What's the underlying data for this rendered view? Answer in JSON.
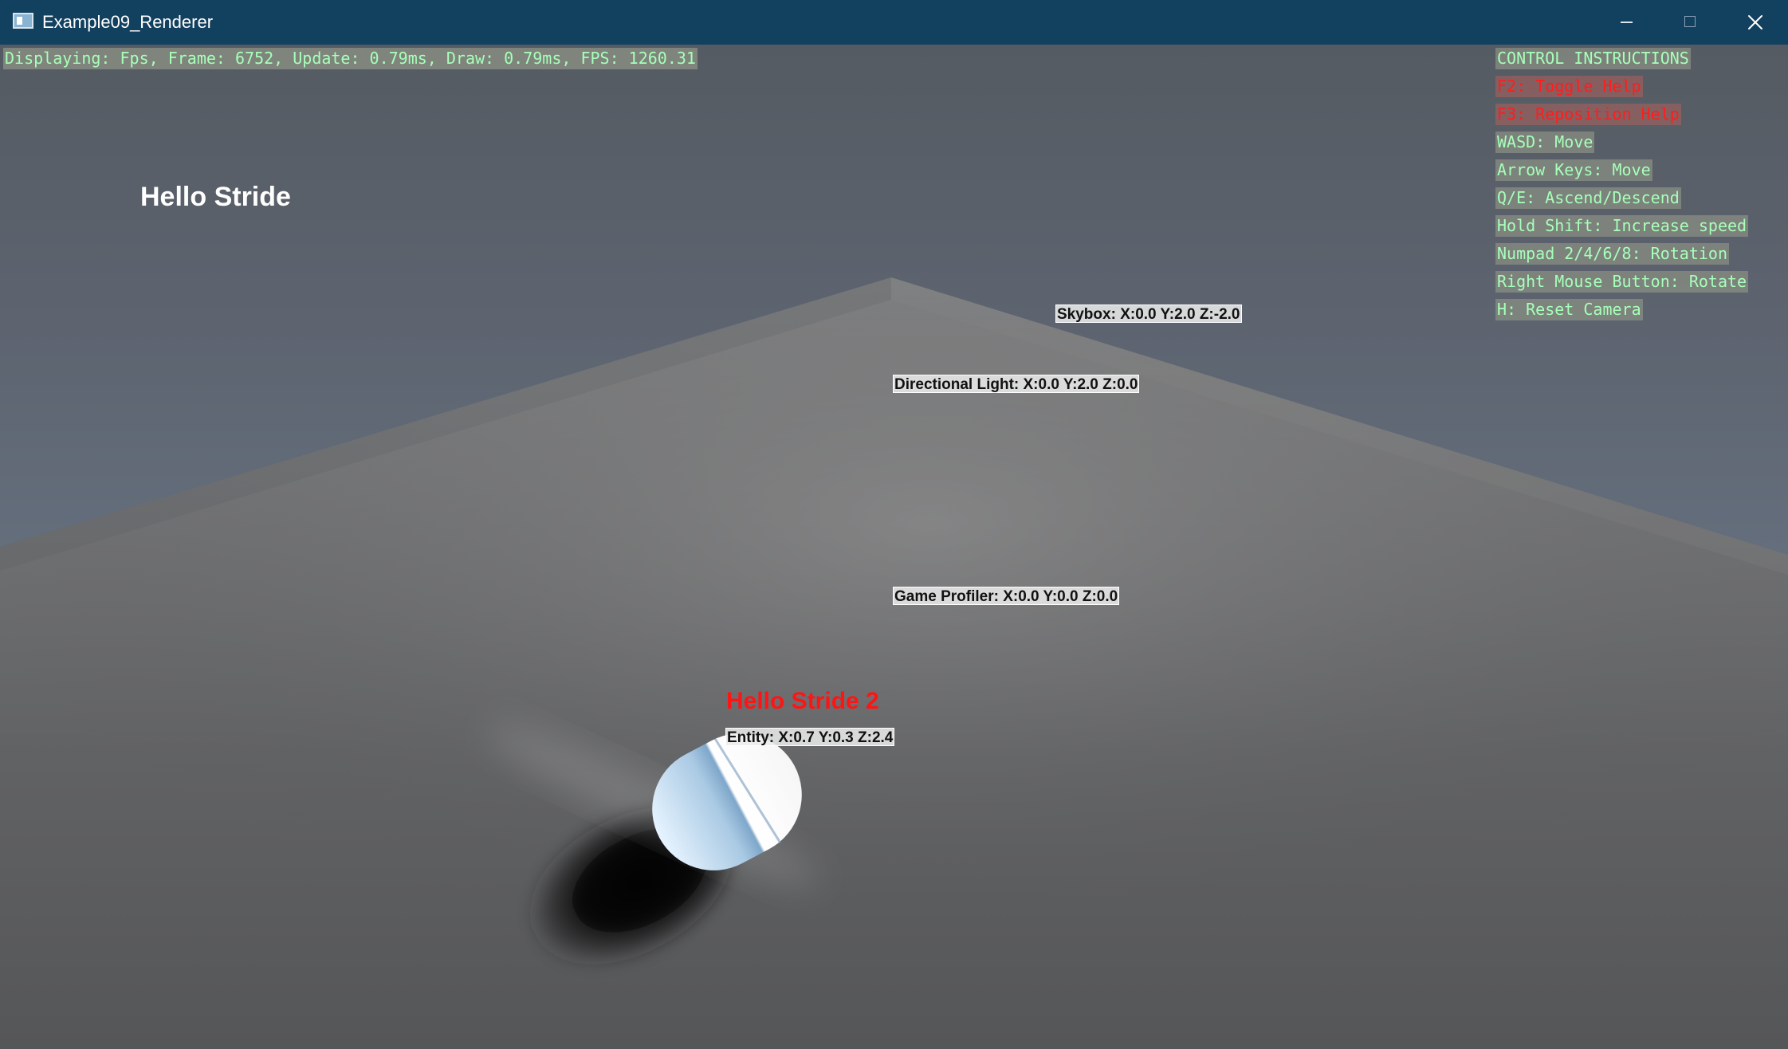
{
  "window": {
    "title": "Example09_Renderer",
    "controls": {
      "minimize": "minimize",
      "maximize": "maximize",
      "close": "close"
    }
  },
  "overlay": {
    "status": "Displaying: Fps, Frame: 6752, Update: 0.79ms, Draw: 0.79ms, FPS: 1260.31",
    "hello": "Hello Stride"
  },
  "help": {
    "lines": [
      {
        "text": "CONTROL INSTRUCTIONS",
        "style": "normal"
      },
      {
        "text": "F2: Toggle Help",
        "style": "red"
      },
      {
        "text": "F3: Reposition Help",
        "style": "red"
      },
      {
        "text": "WASD: Move",
        "style": "normal"
      },
      {
        "text": "Arrow Keys: Move",
        "style": "normal"
      },
      {
        "text": "Q/E: Ascend/Descend",
        "style": "normal"
      },
      {
        "text": "Hold Shift: Increase speed",
        "style": "normal"
      },
      {
        "text": "Numpad 2/4/6/8: Rotation",
        "style": "normal"
      },
      {
        "text": "Right Mouse Button: Rotate",
        "style": "normal"
      },
      {
        "text": "H: Reset Camera",
        "style": "normal"
      }
    ]
  },
  "world_labels": {
    "skybox": "Skybox: X:0.0 Y:2.0 Z:-2.0",
    "directional_light": "Directional Light: X:0.0 Y:2.0 Z:0.0",
    "game_profiler": "Game Profiler: X:0.0 Y:0.0 Z:0.0",
    "entity_title": "Hello Stride 2",
    "entity": "Entity: X:0.7 Y:0.3 Z:2.4"
  },
  "icons": {
    "app": "app-window-icon",
    "minimize": "minimize-icon",
    "maximize": "maximize-icon",
    "close": "close-icon"
  },
  "colors": {
    "titlebar": "#12405F",
    "overlay_text": "#A7FFB9",
    "help_alert_text": "#FF1D1D",
    "entity_title": "#FF1414",
    "hello_text": "#FFFFFF"
  }
}
